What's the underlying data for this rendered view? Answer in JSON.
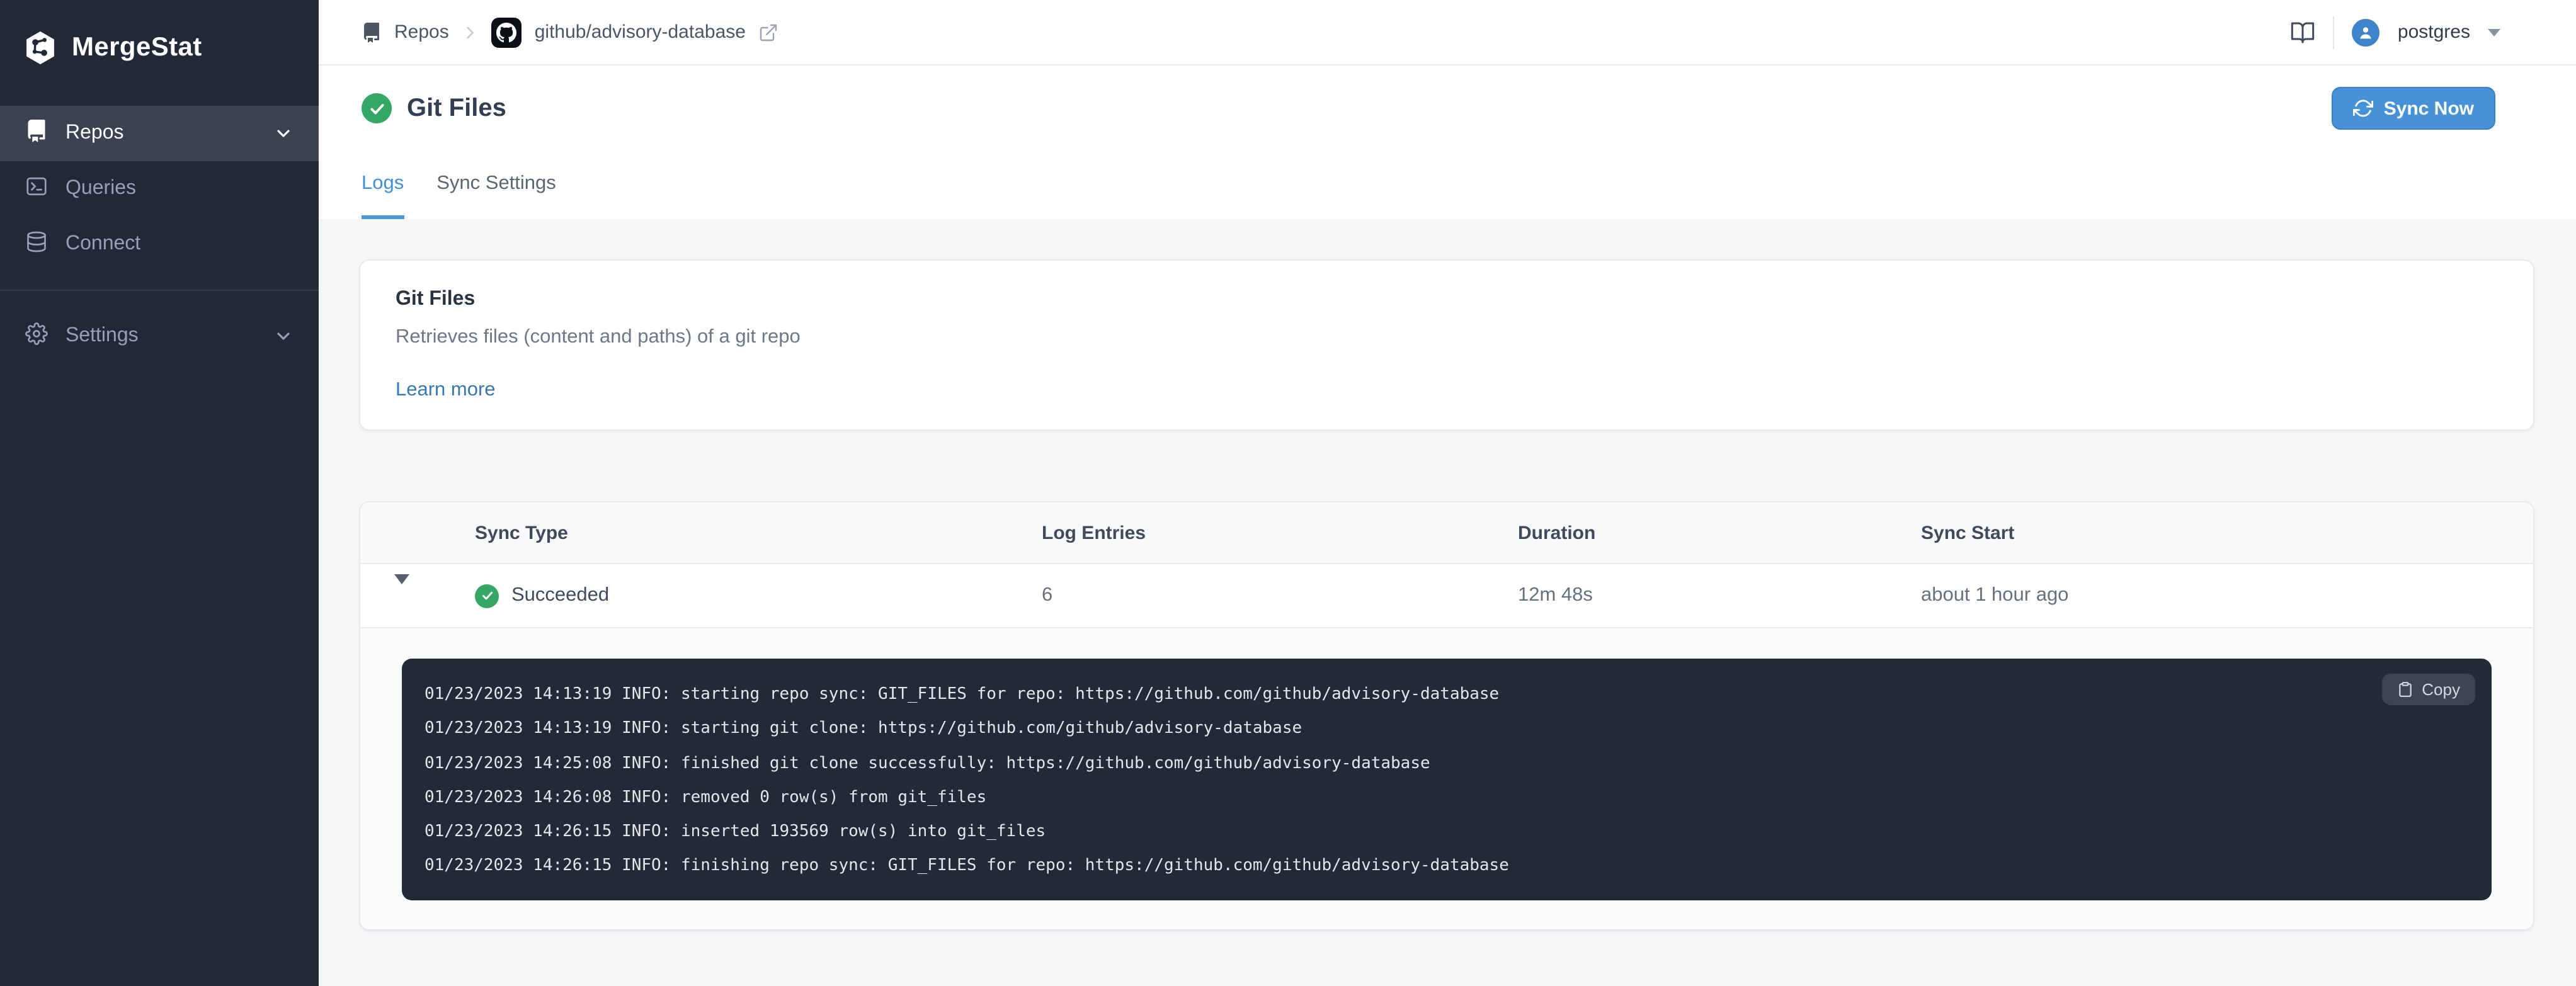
{
  "sidebar": {
    "brand": "MergeStat",
    "items": [
      {
        "label": "Repos"
      },
      {
        "label": "Queries"
      },
      {
        "label": "Connect"
      },
      {
        "label": "Settings"
      }
    ]
  },
  "topbar": {
    "breadcrumb_root": "Repos",
    "breadcrumb_repo": "github/advisory-database",
    "user_name": "postgres"
  },
  "page": {
    "title": "Git Files",
    "sync_now": "Sync Now",
    "tabs": {
      "logs": "Logs",
      "sync_settings": "Sync Settings"
    }
  },
  "info_card": {
    "title": "Git Files",
    "description": "Retrieves files (content and paths) of a git repo",
    "link": "Learn more"
  },
  "table": {
    "columns": [
      "Sync Type",
      "Log Entries",
      "Duration",
      "Sync Start"
    ],
    "row": {
      "status": "Succeeded",
      "log_entries": "6",
      "duration": "12m 48s",
      "sync_start": "about 1 hour ago"
    }
  },
  "log_panel": {
    "copy": "Copy",
    "lines": [
      "01/23/2023 14:13:19 INFO: starting repo sync: GIT_FILES for repo: https://github.com/github/advisory-database",
      "01/23/2023 14:13:19 INFO: starting git clone: https://github.com/github/advisory-database",
      "01/23/2023 14:25:08 INFO: finished git clone successfully: https://github.com/github/advisory-database",
      "01/23/2023 14:26:08 INFO: removed 0 row(s) from git_files",
      "01/23/2023 14:26:15 INFO: inserted 193569 row(s) into git_files",
      "01/23/2023 14:26:15 INFO: finishing repo sync: GIT_FILES for repo: https://github.com/github/advisory-database"
    ]
  },
  "colors": {
    "accent_blue": "#4691d7",
    "tab_blue": "#418fd7",
    "success_green": "#35a764",
    "sidebar_bg": "#212938",
    "terminal_bg": "#222a38",
    "page_bg": "#f5f6f8"
  }
}
